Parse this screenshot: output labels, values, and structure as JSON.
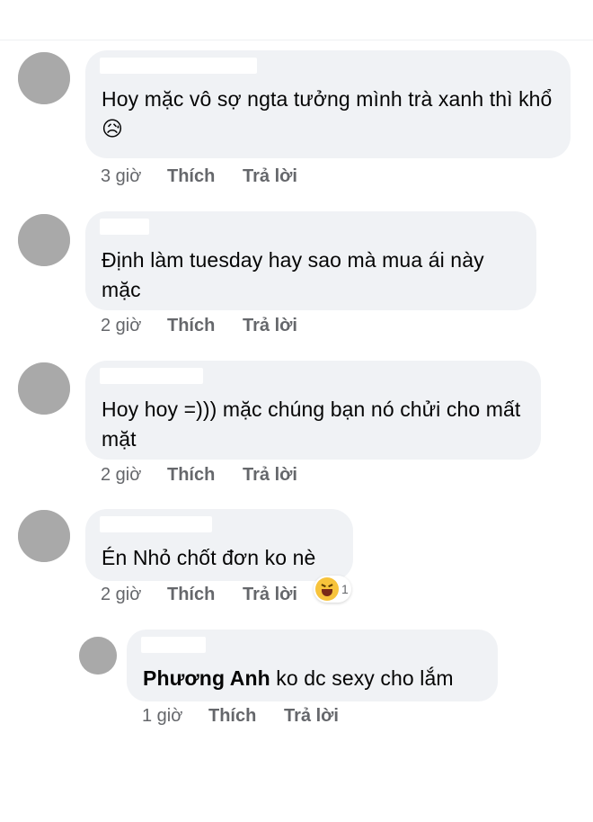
{
  "comments": [
    {
      "text": "Hoy mặc vô sợ ngta tưởng mình trà xanh thì khổ",
      "emoji": "😥",
      "time": "3 giờ",
      "like": "Thích",
      "reply": "Trả lời"
    },
    {
      "text": "Định làm tuesday hay sao mà mua ái này mặc",
      "time": "2 giờ",
      "like": "Thích",
      "reply": "Trả lời"
    },
    {
      "text": "Hoy hoy =))) mặc chúng bạn nó chửi cho mất mặt",
      "time": "2 giờ",
      "like": "Thích",
      "reply": "Trả lời"
    },
    {
      "text": "Én Nhỏ chốt đơn ko nè",
      "time": "2 giờ",
      "like": "Thích",
      "reply": "Trả lời",
      "reaction": {
        "icon": "haha-icon",
        "count": "1"
      }
    }
  ],
  "reply": {
    "mention": "Phương Anh",
    "text": "ko dc sexy cho lắm",
    "time": "1 giờ",
    "like": "Thích",
    "reply": "Trả lời"
  }
}
